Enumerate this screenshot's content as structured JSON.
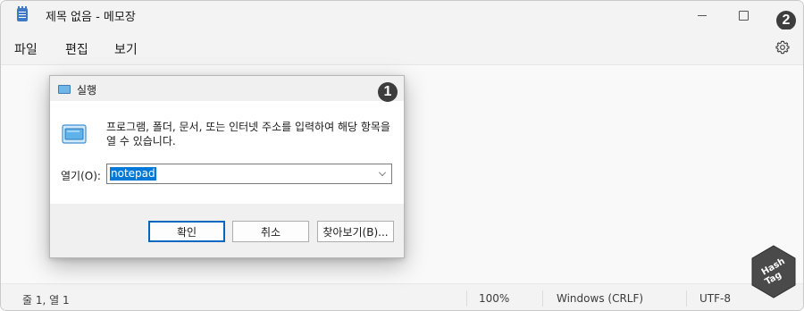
{
  "window": {
    "title": "제목 없음 - 메모장",
    "icon": "notepad-icon"
  },
  "menu": [
    "파일",
    "편집",
    "보기"
  ],
  "annotations": {
    "badge_1": "1",
    "badge_2": "2"
  },
  "status": {
    "position": "줄 1, 열 1",
    "zoom": "100%",
    "line_ending": "Windows (CRLF)",
    "encoding": "UTF-8"
  },
  "logo": {
    "text_line1": "Hash",
    "text_line2": "Tag"
  },
  "run_dialog": {
    "title": "실행",
    "description": "프로그램, 폴더, 문서, 또는 인터넷 주소를 입력하여 해당 항목을 열 수 있습니다.",
    "open_label": "열기(O):",
    "input_value": "notepad",
    "ok_label": "확인",
    "cancel_label": "취소",
    "browse_label": "찾아보기(B)..."
  },
  "colors": {
    "accent": "#0078d7",
    "badge": "#3d3d3d"
  }
}
